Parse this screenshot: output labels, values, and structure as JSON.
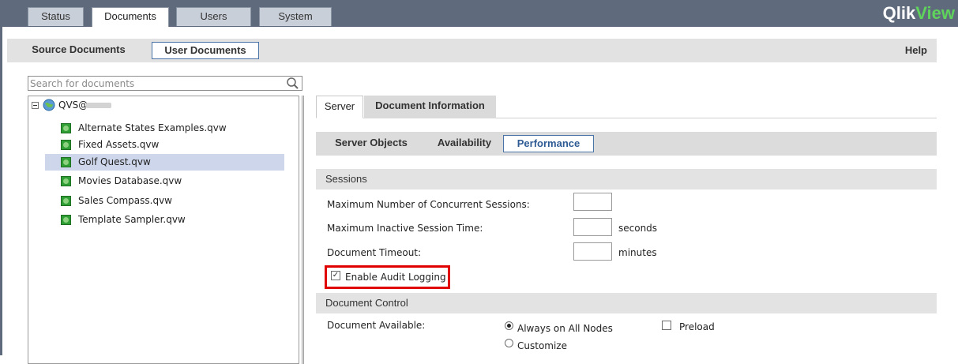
{
  "top_tabs": [
    "Status",
    "Documents",
    "Users",
    "System"
  ],
  "active_top_tab": "Documents",
  "brand": {
    "logo_part1": "Qlik",
    "logo_part2": "View",
    "logo_color_1": "#ffffff",
    "logo_color_2": "#5fd35b"
  },
  "sub_tabs": [
    "Source Documents",
    "User Documents"
  ],
  "active_sub_tab": "User Documents",
  "help_label": "Help",
  "search": {
    "placeholder": "Search for documents",
    "icon": "search-icon"
  },
  "tree": {
    "root_label": "QVS@",
    "items": [
      "Alternate States Examples.qvw",
      "Fixed Assets.qvw",
      "Golf Quest.qvw",
      "Movies Database.qvw",
      "Sales Compass.qvw",
      "Template Sampler.qvw"
    ],
    "selected": "Golf Quest.qvw"
  },
  "doc_tabs": [
    "Server",
    "Document Information"
  ],
  "server_subtabs": [
    "Server Objects",
    "Availability",
    "Performance"
  ],
  "active_server_subtab": "Performance",
  "sessions": {
    "header": "Sessions",
    "max_sessions_label": "Maximum Number of Concurrent Sessions:",
    "max_sessions_value": "",
    "inactive_time_label": "Maximum Inactive Session Time:",
    "inactive_time_value": "",
    "inactive_time_unit": "seconds",
    "doc_timeout_label": "Document Timeout:",
    "doc_timeout_value": "",
    "doc_timeout_unit": "minutes",
    "audit_label": "Enable Audit Logging",
    "audit_checked": true
  },
  "doc_control": {
    "header": "Document Control",
    "available_label": "Document Available:",
    "option_always": "Always on All Nodes",
    "option_customize": "Customize",
    "preload_label": "Preload",
    "selected_option": "Always on All Nodes",
    "preload_checked": false
  },
  "colors": {
    "accent": "#4a74a8",
    "highlight_box": "#e00000",
    "selection": "#cdd6ea",
    "topbar": "#5f6b7c"
  }
}
